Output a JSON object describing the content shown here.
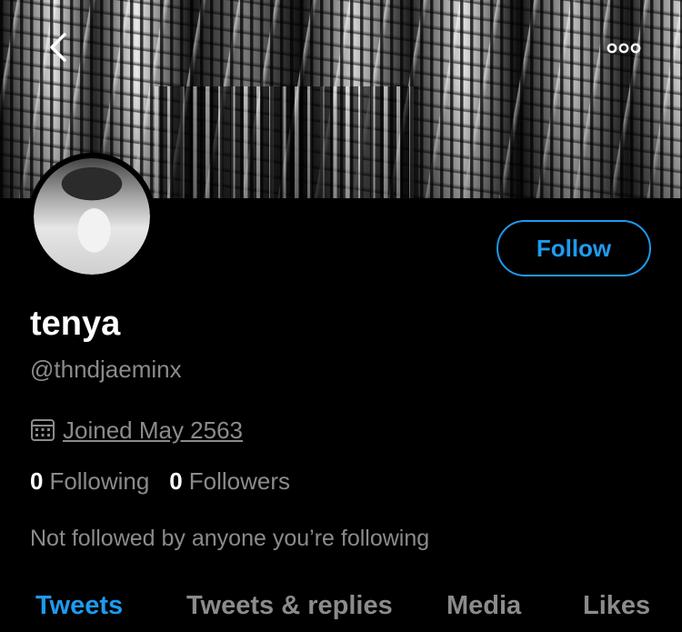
{
  "header": {
    "back_icon": "chevron-left-icon",
    "more_icon": "more-horizontal-icon"
  },
  "profile": {
    "display_name": "tenya",
    "handle": "@thndjaeminx",
    "joined": "Joined May 2563",
    "following_count": "0",
    "following_label": "Following",
    "followers_count": "0",
    "followers_label": "Followers",
    "followed_by_note": "Not followed by anyone you’re following"
  },
  "actions": {
    "follow_label": "Follow"
  },
  "tabs": [
    {
      "label": "Tweets",
      "active": true
    },
    {
      "label": "Tweets & replies",
      "active": false
    },
    {
      "label": "Media",
      "active": false
    },
    {
      "label": "Likes",
      "active": false
    }
  ],
  "colors": {
    "accent": "#1d9bf0",
    "muted": "#8b8b8b",
    "background": "#000000"
  }
}
